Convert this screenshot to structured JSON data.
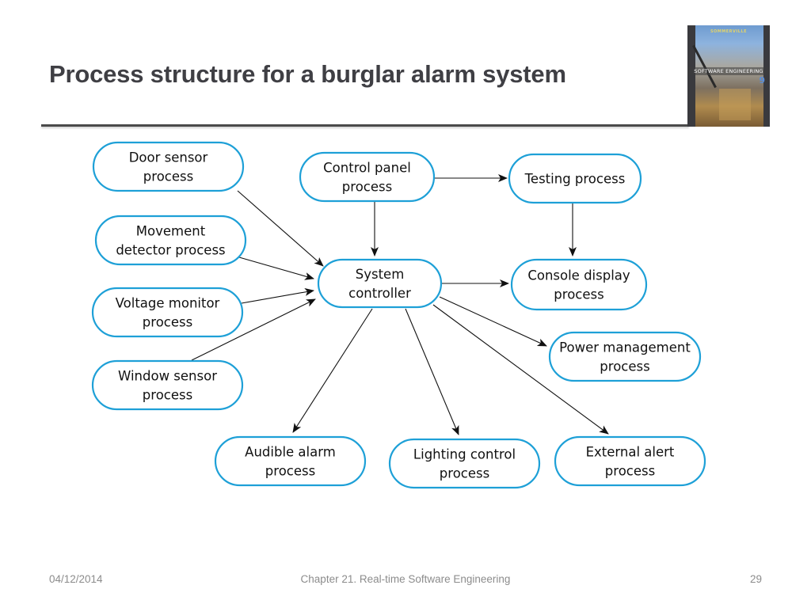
{
  "slide": {
    "title": "Process structure for a burglar alarm system",
    "book_cover": {
      "author": "SOMMERVILLE",
      "title": "SOFTWARE ENGINEERING",
      "edition": "9"
    },
    "footer": {
      "date": "04/12/2014",
      "chapter": "Chapter 21. Real-time Software Engineering",
      "page": "29"
    }
  },
  "colors": {
    "node_border": "#1ea0d7",
    "title_text": "#3f3f44",
    "footer_text": "#8c8c8c"
  },
  "diagram": {
    "nodes": [
      {
        "id": "door",
        "lines": [
          "Door sensor",
          "process"
        ]
      },
      {
        "id": "movement",
        "lines": [
          "Movement",
          "detector process"
        ]
      },
      {
        "id": "voltage",
        "lines": [
          "Voltage monitor",
          "process"
        ]
      },
      {
        "id": "window",
        "lines": [
          "Window sensor",
          "process"
        ]
      },
      {
        "id": "control",
        "lines": [
          "Control panel",
          "process"
        ]
      },
      {
        "id": "testing",
        "lines": [
          "Testing process"
        ]
      },
      {
        "id": "system",
        "lines": [
          "System",
          "controller"
        ]
      },
      {
        "id": "console",
        "lines": [
          "Console display",
          "process"
        ]
      },
      {
        "id": "power",
        "lines": [
          "Power management",
          "process"
        ]
      },
      {
        "id": "audible",
        "lines": [
          "Audible alarm",
          "process"
        ]
      },
      {
        "id": "lighting",
        "lines": [
          "Lighting control",
          "process"
        ]
      },
      {
        "id": "external",
        "lines": [
          "External alert",
          "process"
        ]
      }
    ],
    "edges": [
      {
        "from": "door",
        "to": "system"
      },
      {
        "from": "movement",
        "to": "system"
      },
      {
        "from": "voltage",
        "to": "system"
      },
      {
        "from": "window",
        "to": "system"
      },
      {
        "from": "control",
        "to": "system"
      },
      {
        "from": "control",
        "to": "testing"
      },
      {
        "from": "testing",
        "to": "console"
      },
      {
        "from": "system",
        "to": "console"
      },
      {
        "from": "system",
        "to": "power"
      },
      {
        "from": "system",
        "to": "audible"
      },
      {
        "from": "system",
        "to": "lighting"
      },
      {
        "from": "system",
        "to": "external"
      }
    ]
  }
}
